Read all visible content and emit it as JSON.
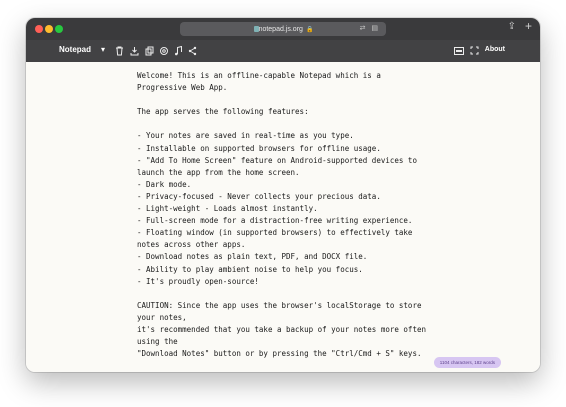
{
  "browser": {
    "url": "notepad.js.org",
    "tool_icons": [
      "translate-icon",
      "reader-icon"
    ]
  },
  "toolbar": {
    "app_name": "Notepad",
    "icons": [
      "trash-icon",
      "download-icon",
      "copy-icon",
      "settings-icon",
      "music-icon",
      "share-icon"
    ],
    "right_icons": [
      "picture-in-picture-icon",
      "fullscreen-icon"
    ],
    "about_label": "About"
  },
  "note": {
    "lines": [
      "Welcome! This is an offline-capable Notepad which is a",
      "Progressive Web App.",
      "",
      "The app serves the following features:",
      "",
      "- Your notes are saved in real-time as you type.",
      "- Installable on supported browsers for offline usage.",
      "- \"Add To Home Screen\" feature on Android-supported devices to",
      "launch the app from the home screen.",
      "- Dark mode.",
      "- Privacy-focused - Never collects your precious data.",
      "- Light-weight - Loads almost instantly.",
      "- Full-screen mode for a distraction-free writing experience.",
      "- Floating window (in supported browsers) to effectively take",
      "notes across other apps.",
      "- Download notes as plain text, PDF, and DOCX file.",
      "- Ability to play ambient noise to help you focus.",
      "- It's proudly open-source!",
      "",
      "CAUTION: Since the app uses the browser's localStorage to store",
      "your notes,",
      "it's recommended that you take a backup of your notes more often",
      "using the",
      "\"Download Notes\" button or by pressing the \"Ctrl/Cmd + S\" keys."
    ]
  },
  "status": {
    "counter": "1104 characters, 182 words"
  },
  "colors": {
    "toolbar_bg": "#424244",
    "titlebar_bg": "#3a3a3c",
    "page_bg": "#fbfaf6",
    "counter_bg": "#d7c6f2"
  }
}
